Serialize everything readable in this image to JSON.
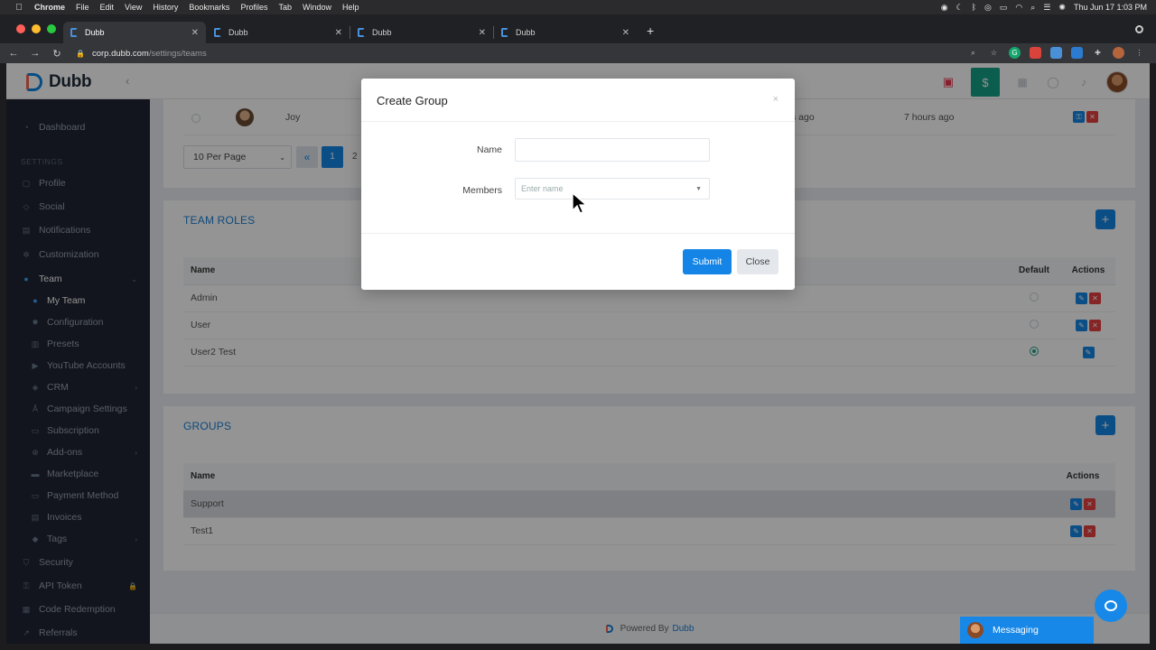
{
  "menubar": {
    "app": "Chrome",
    "items": [
      "File",
      "Edit",
      "View",
      "History",
      "Bookmarks",
      "Profiles",
      "Tab",
      "Window",
      "Help"
    ],
    "clock": "Thu Jun 17  1:03 PM"
  },
  "tabs": [
    {
      "title": "Dubb"
    },
    {
      "title": "Dubb"
    },
    {
      "title": "Dubb"
    },
    {
      "title": "Dubb"
    }
  ],
  "address": {
    "host": "corp.dubb.com",
    "path": "/settings/teams"
  },
  "app": {
    "brand": "Dubb",
    "accent": "#1485e6"
  },
  "sidebar": {
    "dashboard": "Dashboard",
    "section_settings": "SETTINGS",
    "items": [
      {
        "label": "Profile"
      },
      {
        "label": "Social"
      },
      {
        "label": "Notifications"
      },
      {
        "label": "Customization"
      },
      {
        "label": "Team"
      },
      {
        "label": "My Team"
      },
      {
        "label": "Configuration"
      },
      {
        "label": "Presets"
      },
      {
        "label": "YouTube Accounts"
      },
      {
        "label": "CRM"
      },
      {
        "label": "Campaign Settings"
      },
      {
        "label": "Subscription"
      },
      {
        "label": "Add-ons"
      },
      {
        "label": "Marketplace"
      },
      {
        "label": "Payment Method"
      },
      {
        "label": "Invoices"
      },
      {
        "label": "Tags"
      },
      {
        "label": "Security"
      },
      {
        "label": "API Token"
      },
      {
        "label": "Code Redemption"
      },
      {
        "label": "Referrals"
      }
    ]
  },
  "members_row": {
    "name": "Joy",
    "created": "s ago",
    "updated": "7 hours ago"
  },
  "pagination": {
    "per_page": "10 Per Page",
    "prev": "«",
    "current": "1",
    "next_page": "2"
  },
  "team_roles": {
    "title": "TEAM ROLES",
    "headers": {
      "name": "Name",
      "default": "Default",
      "actions": "Actions"
    },
    "rows": [
      {
        "name": "Admin",
        "default": false
      },
      {
        "name": "User",
        "default": false
      },
      {
        "name": "User2 Test",
        "default": true
      }
    ]
  },
  "groups": {
    "title": "GROUPS",
    "headers": {
      "name": "Name",
      "actions": "Actions"
    },
    "rows": [
      {
        "name": "Support"
      },
      {
        "name": "Test1"
      }
    ]
  },
  "footer": {
    "powered_by": "Powered By",
    "brand": "Dubb"
  },
  "messaging": {
    "label": "Messaging"
  },
  "modal": {
    "title": "Create Group",
    "close_x": "×",
    "name_label": "Name",
    "name_value": "",
    "members_label": "Members",
    "members_placeholder": "Enter name",
    "submit": "Submit",
    "close": "Close"
  }
}
